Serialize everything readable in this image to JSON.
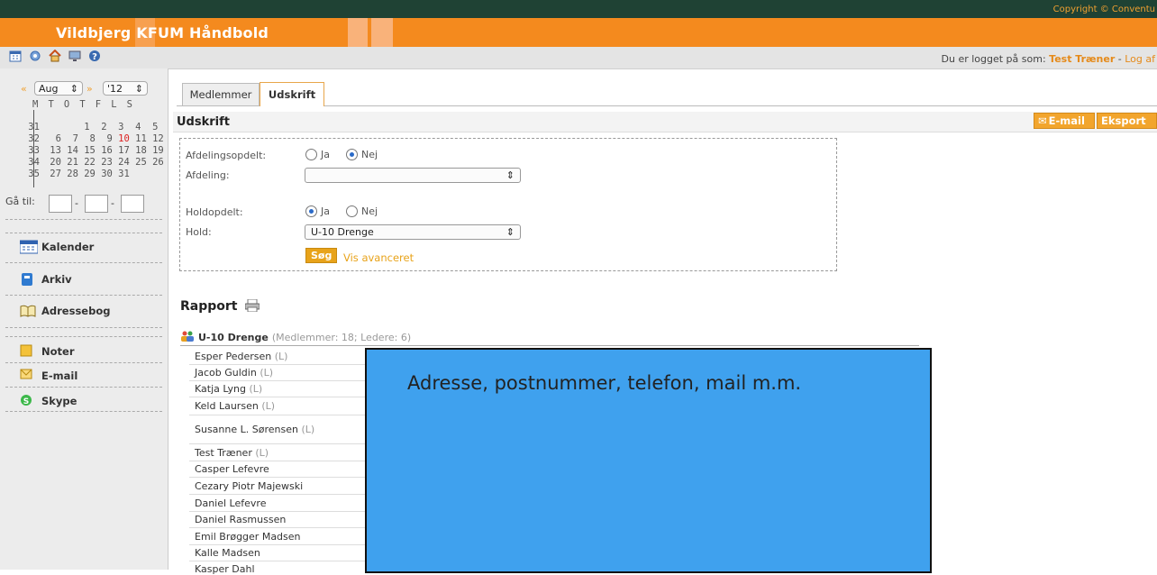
{
  "header": {
    "copyright": "Copyright © Conventu",
    "title": "Vildbjerg KFUM Håndbold",
    "login_prefix": "Du er logget på som:",
    "user": "Test Træner",
    "logout": "Log af",
    "colors": {
      "topbar": "#1f4234",
      "banner": "#f48a1e",
      "accent": "#f2a52d"
    }
  },
  "toolbar": {
    "icons": [
      "calendar-icon",
      "settings-icon",
      "home-icon",
      "computer-icon",
      "help-icon"
    ]
  },
  "sidebar": {
    "month": "Aug",
    "year": "'12",
    "weekday_header": "M T O T F L S",
    "calendar_rows": [
      {
        "week": "31",
        "days": "      1  2  3  4  5"
      },
      {
        "week": "32",
        "days": " 6  7  8  9 10 11 12"
      },
      {
        "week": "33",
        "days": "13 14 15 16 17 18 19"
      },
      {
        "week": "34",
        "days": "20 21 22 23 24 25 26"
      },
      {
        "week": "35",
        "days": "27 28 29 30 31"
      }
    ],
    "goto_label": "Gå til:",
    "nav": [
      {
        "label": "Kalender"
      },
      {
        "label": "Arkiv"
      },
      {
        "label": "Adressebog"
      },
      {
        "label": "Noter"
      },
      {
        "label": "E-mail"
      },
      {
        "label": "Skype"
      }
    ]
  },
  "main": {
    "tabs": [
      {
        "label": "Medlemmer"
      },
      {
        "label": "Udskrift"
      }
    ],
    "section_title": "Udskrift",
    "email_button": "E-mail",
    "export_button": "Eksport",
    "filter": {
      "afdelingsopdelt_label": "Afdelingsopdelt:",
      "afdeling_label": "Afdeling:",
      "afdeling_value": "",
      "holdopdelt_label": "Holdopdelt:",
      "hold_label": "Hold:",
      "hold_value": "U-10 Drenge",
      "ja": "Ja",
      "nej": "Nej",
      "search_button": "Søg",
      "advanced_link": "Vis avanceret"
    },
    "report_title": "Rapport",
    "group": {
      "name": "U-10 Drenge",
      "meta": "(Medlemmer: 18; Ledere: 6)"
    },
    "members": [
      {
        "name": "Esper Pedersen",
        "badge": "(L)"
      },
      {
        "name": "Jacob Guldin",
        "badge": "(L)"
      },
      {
        "name": "Katja Lyng",
        "badge": "(L)"
      },
      {
        "name": "Keld Laursen",
        "badge": "(L)"
      },
      {
        "name": "Susanne L. Sørensen",
        "badge": "(L)"
      },
      {
        "name": "Test Træner",
        "badge": "(L)"
      },
      {
        "name": "Casper Lefevre",
        "badge": ""
      },
      {
        "name": "Cezary Piotr Majewski",
        "badge": ""
      },
      {
        "name": "Daniel Lefevre",
        "badge": ""
      },
      {
        "name": "Daniel Rasmussen",
        "badge": ""
      },
      {
        "name": "Emil Brøgger Madsen",
        "badge": ""
      },
      {
        "name": "Kalle Madsen",
        "badge": ""
      },
      {
        "name": "Kasper Dahl",
        "badge": ""
      }
    ],
    "overlay_text": "Adresse, postnummer, telefon, mail m.m."
  }
}
